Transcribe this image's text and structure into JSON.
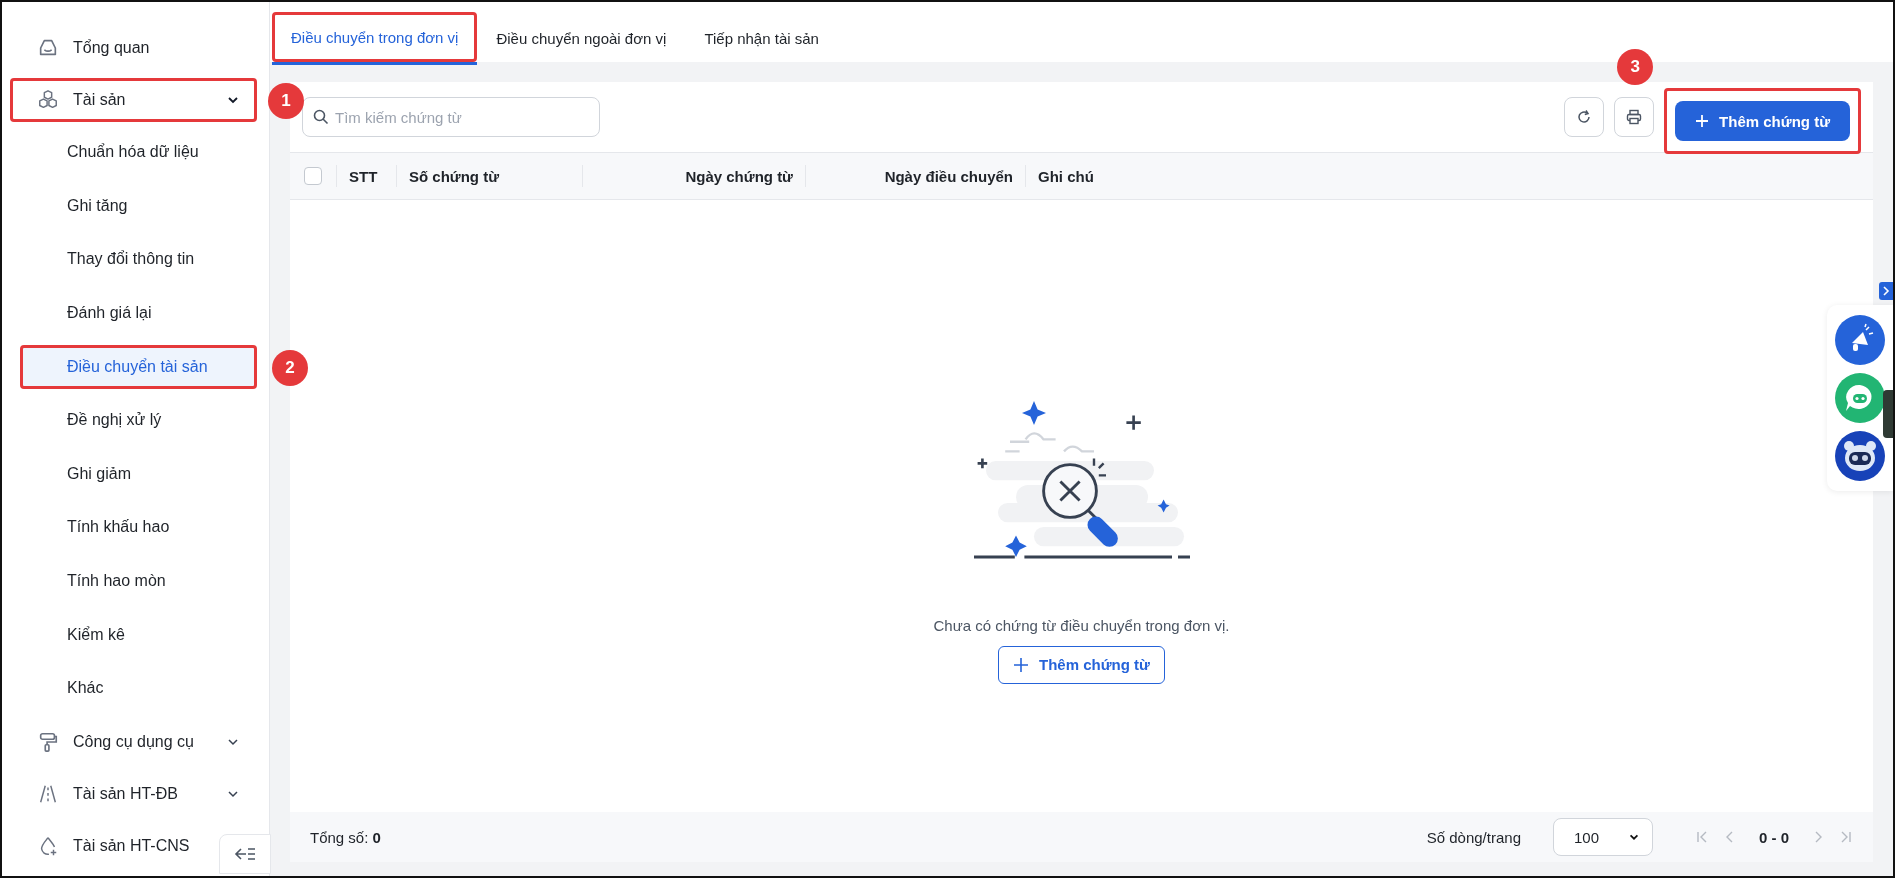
{
  "sidebar": {
    "items": [
      {
        "kind": "link",
        "label": "Tổng quan"
      },
      {
        "kind": "group",
        "label": "Tài sản",
        "expanded": true,
        "callout": "1",
        "children": [
          {
            "label": "Chuẩn hóa dữ liệu",
            "selected": false
          },
          {
            "label": "Ghi tăng",
            "selected": false
          },
          {
            "label": "Thay đổi thông tin",
            "selected": false
          },
          {
            "label": "Đánh giá lại",
            "selected": false
          },
          {
            "label": "Điều chuyển tài sản",
            "selected": true,
            "callout": "2"
          },
          {
            "label": "Đề nghị xử lý",
            "selected": false
          },
          {
            "label": "Ghi giảm",
            "selected": false
          },
          {
            "label": "Tính khấu hao",
            "selected": false
          },
          {
            "label": "Tính hao mòn",
            "selected": false
          },
          {
            "label": "Kiểm kê",
            "selected": false
          },
          {
            "label": "Khác",
            "selected": false
          }
        ]
      },
      {
        "kind": "group",
        "label": "Công cụ dụng cụ",
        "expanded": false
      },
      {
        "kind": "group",
        "label": "Tài sản HT-ĐB",
        "expanded": false
      },
      {
        "kind": "link",
        "label": "Tài sản HT-CNS"
      }
    ]
  },
  "tabs": [
    {
      "label": "Điều chuyển trong đơn vị",
      "selected": true,
      "highlighted": true
    },
    {
      "label": "Điều chuyển ngoài đơn vị",
      "selected": false,
      "highlighted": false
    },
    {
      "label": "Tiếp nhận tài sản",
      "selected": false,
      "highlighted": false
    }
  ],
  "toolbar": {
    "search": {
      "placeholder": "Tìm kiếm chứng từ"
    },
    "add_button": {
      "label": "Thêm chứng từ",
      "callout": "3"
    }
  },
  "table": {
    "select_all_checked": false,
    "columns": [
      "STT",
      "Số chứng từ",
      "Ngày chứng từ",
      "Ngày điều chuyển",
      "Ghi chú"
    ]
  },
  "empty_state": {
    "message": "Chưa có chứng từ điều chuyển trong đơn vị.",
    "button": "Thêm chứng từ"
  },
  "footer": {
    "total_label": "Tổng số:",
    "total": "0",
    "page_size_label": "Số dòng/trang",
    "page_size": "100",
    "range": "0 - 0"
  }
}
